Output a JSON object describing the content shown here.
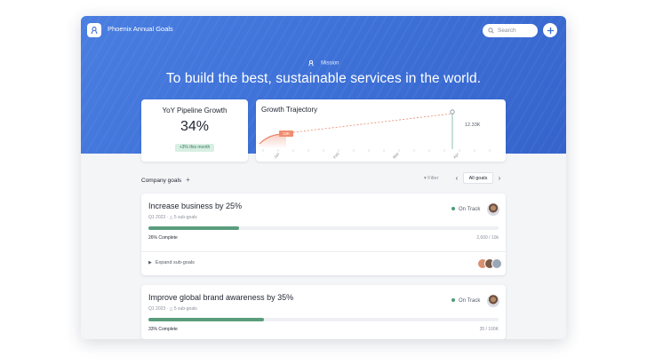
{
  "app": {
    "title": "Phoenix Annual Goals",
    "search_placeholder": "Search",
    "logo_icon": "app-logo-icon"
  },
  "hero": {
    "mission_label": "Mission",
    "mission_text": "To build the best, sustainable services in the world."
  },
  "metric": {
    "title": "YoY Pipeline Growth",
    "value": "34%",
    "badge": "+3% this month"
  },
  "trend": {
    "title": "Growth Trajectory",
    "current_value": "12.33K",
    "marker_label": "12K",
    "month_labels": [
      "Jan",
      "Feb",
      "Mar",
      "Apr"
    ]
  },
  "toolbar": {
    "label": "Company goals",
    "filter_label": "Filter",
    "range_label": "All goals"
  },
  "goals": [
    {
      "title": "Increase business by 25%",
      "meta": "Q1 2023 · △ 5 sub-goals",
      "status": "On Track",
      "progress": 0.26,
      "complete_label": "26% Complete",
      "count": "2,600 / 10k",
      "expand_label": "Expand sub-goals"
    },
    {
      "title": "Improve global brand awareness by 35%",
      "meta": "Q1 2023 · △ 5 sub-goals",
      "status": "On Track",
      "progress": 0.33,
      "complete_label": "33% Complete",
      "count": "35 / 100K"
    }
  ],
  "colors": {
    "hero": "#3c6fd6",
    "accent_green": "#5a9d7c",
    "trend_orange": "#e8866a"
  }
}
